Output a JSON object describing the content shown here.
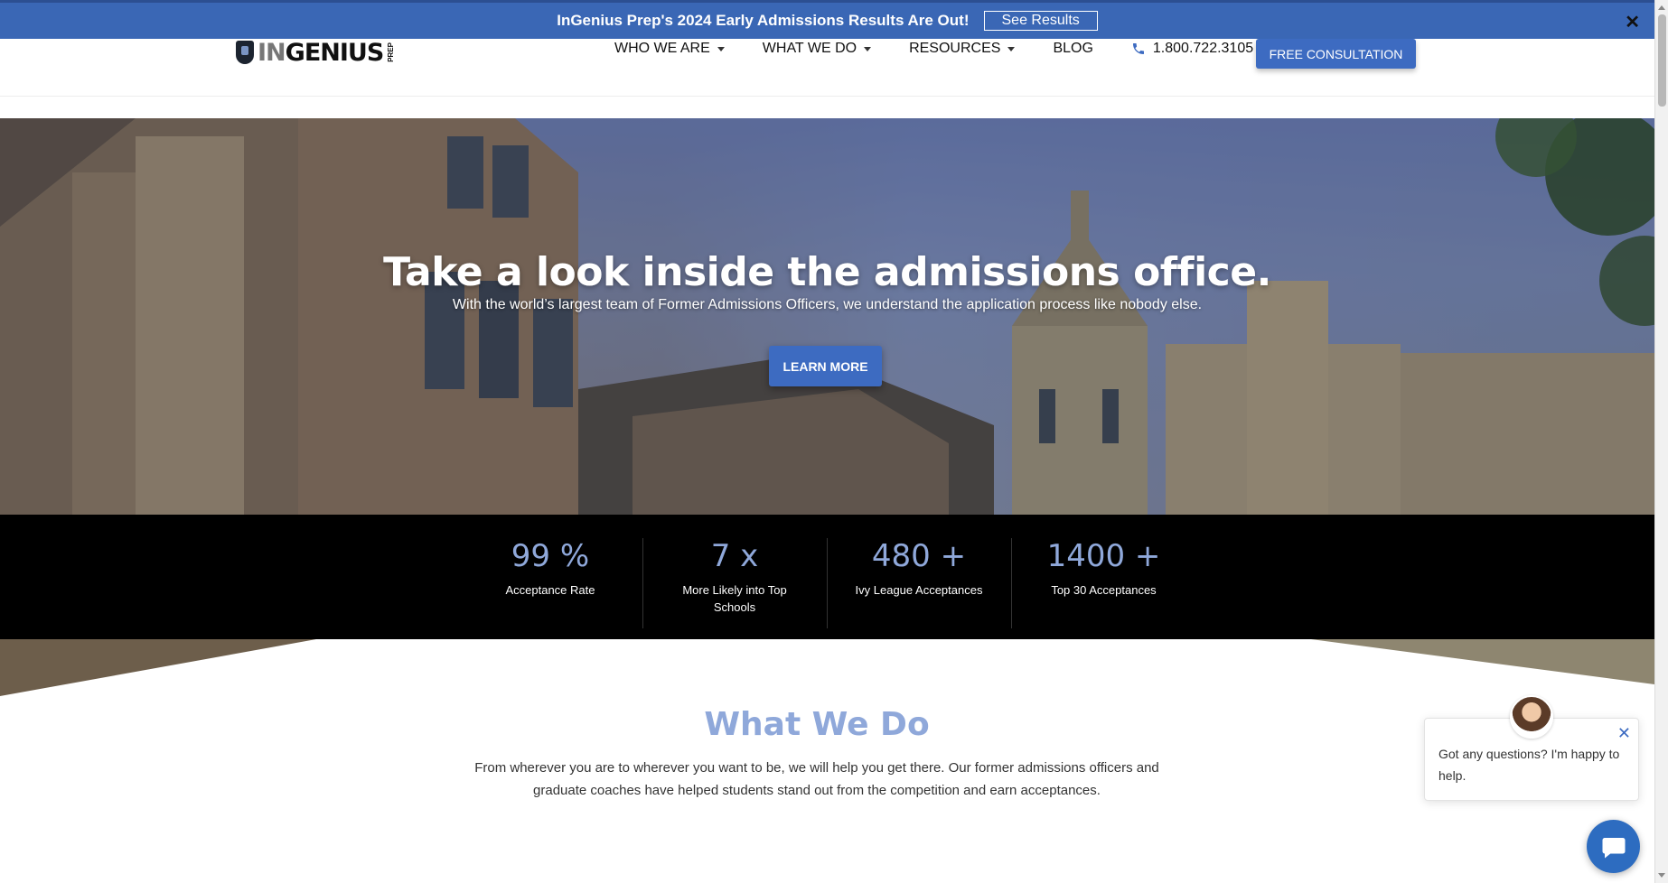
{
  "announcement": {
    "text": "InGenius Prep's 2024 Early Admissions Results Are Out!",
    "button_label": "See Results",
    "close_symbol": "✕"
  },
  "header": {
    "logo_text_in": "IN",
    "logo_text_genius": "GENIUS",
    "logo_text_prep": "PREP",
    "nav": [
      {
        "label": "WHO WE ARE"
      },
      {
        "label": "WHAT WE DO"
      },
      {
        "label": "RESOURCES"
      },
      {
        "label": "BLOG"
      }
    ],
    "phone": "1.800.722.3105",
    "cta_label": "FREE CONSULTATION"
  },
  "hero": {
    "title": "Take a look inside the admissions office.",
    "subtitle": "With the world’s largest team of Former Admissions Officers, we understand the application process like nobody else.",
    "button_label": "LEARN MORE"
  },
  "stats": [
    {
      "value": "99 %",
      "label": "Acceptance Rate"
    },
    {
      "value": "7 x",
      "label": "More Likely into Top Schools"
    },
    {
      "value": "480 +",
      "label": "Ivy League Acceptances"
    },
    {
      "value": "1400 +",
      "label": "Top 30 Acceptances"
    }
  ],
  "what_we_do": {
    "title": "What We Do",
    "text": "From wherever you are to wherever you want to be, we will help you get there. Our former admissions officers and graduate coaches have helped students stand out from the competition and earn acceptances."
  },
  "chat": {
    "message": "Got any questions? I'm happy to help.",
    "close_symbol": "✕"
  },
  "colors": {
    "brand_blue": "#3d6bc1",
    "announce_blue": "#3a67b5",
    "stat_blue": "#8fa8da"
  }
}
